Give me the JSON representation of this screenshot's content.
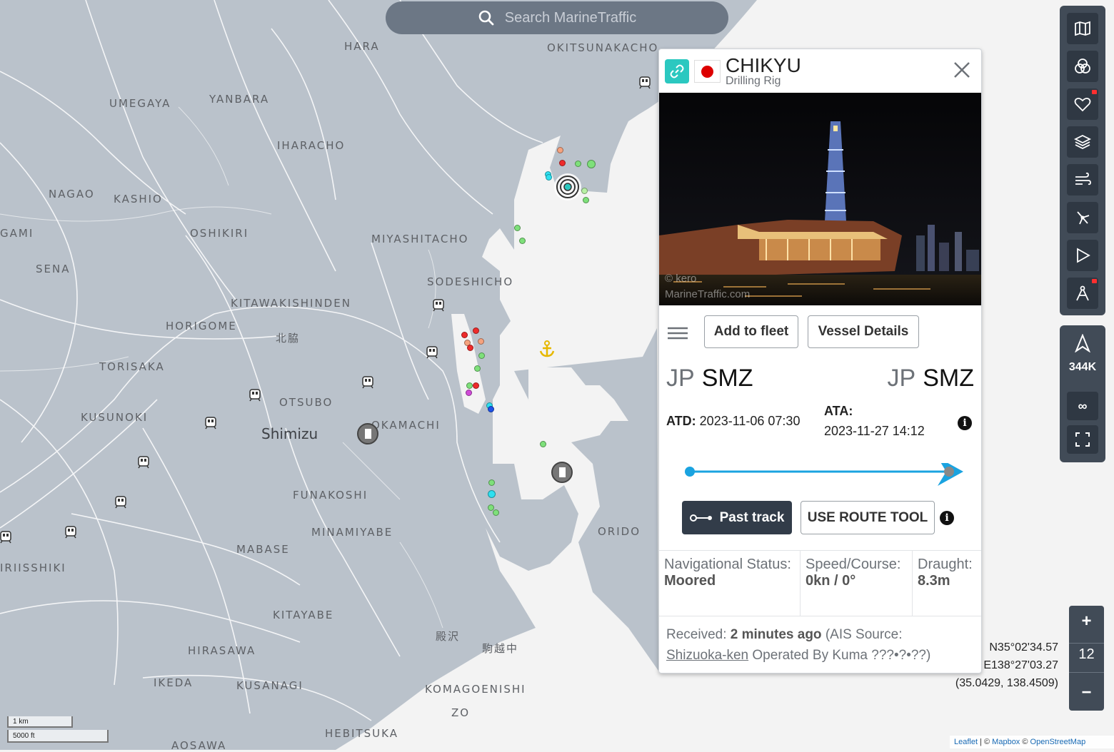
{
  "search": {
    "placeholder": "Search MarineTraffic"
  },
  "map": {
    "place_labels": [
      "HARA",
      "OKITSUNAKACHO",
      "UMEGAYA",
      "YANBARA",
      "IHARACHO",
      "NAGAO",
      "KASHIO",
      "OSHIKIRI",
      "MIYASHITACHO",
      "GAMI",
      "SENA",
      "SODESHICHO",
      "KITAWAKISHINDEN",
      "HORIGOME",
      "北脇",
      "TORISAKA",
      "OTSUBO",
      "KUSUNOKI",
      "Shimizu",
      "OKAMACHI",
      "FUNAKOSHI",
      "MINAMIYABE",
      "ORIDO",
      "MABASE",
      "IRIISSHIKI",
      "KITAYABE",
      "殿沢",
      "駒越中",
      "HIRASAWA",
      "IKEDA",
      "KUSANAGI",
      "KOMAGOENISHI",
      "ZO",
      "HEBITSUKA",
      "AOSAWA"
    ],
    "scale_km": "1 km",
    "scale_ft": "5000 ft",
    "attribution": {
      "leaflet": "Leaflet",
      "sep1": " | © ",
      "mapbox": "Mapbox",
      "sep2": " © ",
      "osm": "OpenStreetMap"
    }
  },
  "vessel": {
    "name": "CHIKYU",
    "type": "Drilling Rig",
    "flag_country": "Japan",
    "photo_credit_1": "© kero",
    "photo_credit_2": "MarineTraffic.com",
    "add_to_fleet": "Add to fleet",
    "vessel_details": "Vessel Details",
    "departure_country": "JP",
    "departure_port": "SMZ",
    "arrival_country": "JP",
    "arrival_port": "SMZ",
    "atd_label": "ATD:",
    "atd_value": "2023-11-06 07:30",
    "ata_label": "ATA:",
    "ata_value": "2023-11-27 14:12",
    "voyage_progress": 1.0,
    "past_track": "Past track",
    "route_tool": "USE ROUTE TOOL",
    "nav_status_label": "Navigational Status:",
    "nav_status_value": "Moored",
    "speed_label": "Speed/Course:",
    "speed_value": "0kn / 0°",
    "draught_label": "Draught:",
    "draught_value": "8.3m",
    "received_label": "Received:",
    "received_value": "2 minutes ago",
    "ais_prefix": "(AIS Source:",
    "ais_source": "Shizuoka-ken",
    "ais_suffix": "Operated By Kuma ???•?•??)"
  },
  "toolbar": {
    "icons": [
      "map-icon",
      "filters-icon",
      "favorites-icon",
      "layers-icon",
      "weather-icon",
      "density-icon",
      "play-icon",
      "measure-icon"
    ],
    "vessel_count": "344K",
    "link_label": "∞"
  },
  "zoom": {
    "in": "+",
    "level": "12",
    "out": "−"
  },
  "coords": {
    "lat": "N35°02'34.57",
    "lon": "E138°27'03.27",
    "decimal": "(35.0429, 138.4509)"
  },
  "colors": {
    "water": "#f3f3f3",
    "land": "#bac2cb",
    "accent": "#1aa3e0",
    "toolbar": "#414b57"
  }
}
